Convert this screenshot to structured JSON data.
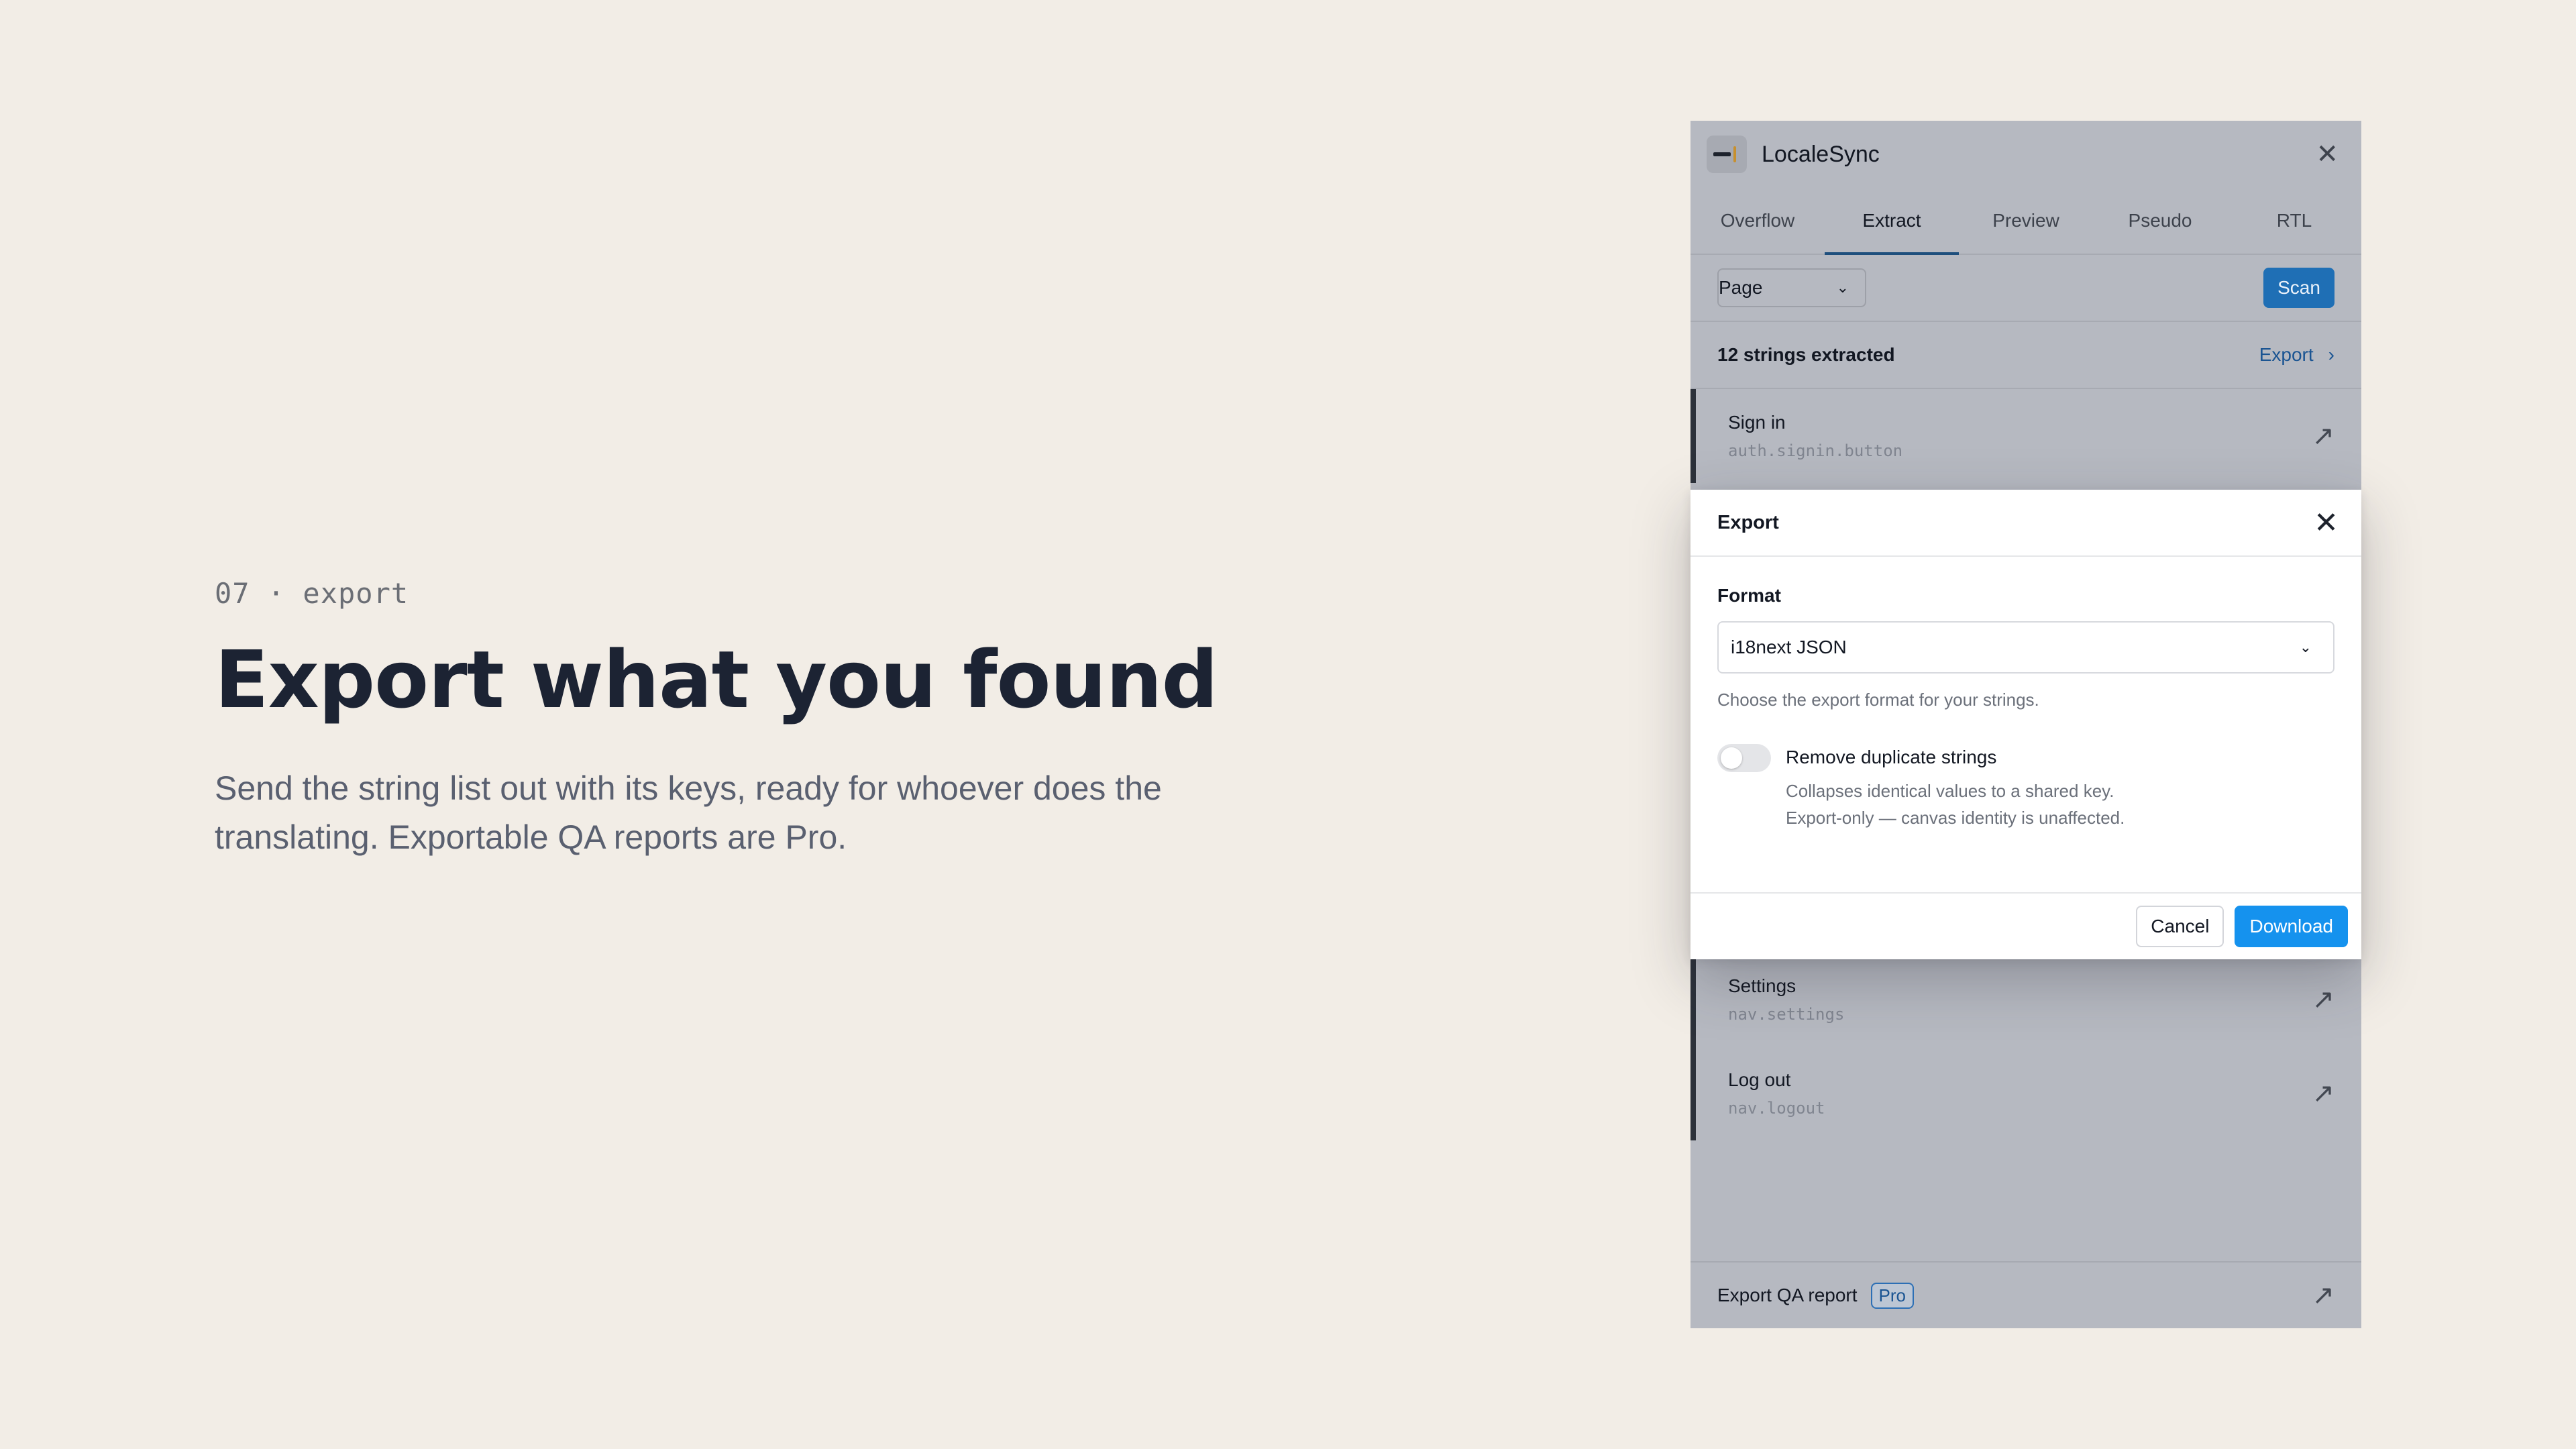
{
  "hero": {
    "eyebrow": "07 · export",
    "headline": "Export what you found",
    "lede": "Send the string list out with its keys, ready for whoever does the translating. Exportable QA reports are Pro."
  },
  "panel": {
    "app_title": "LocaleSync",
    "close_glyph": "✕",
    "tabs": [
      {
        "label": "Overflow",
        "active": false
      },
      {
        "label": "Extract",
        "active": true
      },
      {
        "label": "Preview",
        "active": false
      },
      {
        "label": "Pseudo",
        "active": false
      },
      {
        "label": "RTL",
        "active": false
      }
    ],
    "scope_select": {
      "value": "Page"
    },
    "scan_label": "Scan",
    "summary": "12 strings extracted",
    "export_link": "Export",
    "strings": [
      {
        "label": "Sign in",
        "key": "auth.signin.button"
      },
      {
        "label": "Settings",
        "key": "nav.settings"
      },
      {
        "label": "Log out",
        "key": "nav.logout"
      }
    ],
    "footer": {
      "label": "Export QA report",
      "badge": "Pro"
    }
  },
  "dialog": {
    "title": "Export",
    "format_label": "Format",
    "format_value": "i18next JSON",
    "format_help": "Choose the export format for your strings.",
    "dedupe": {
      "label": "Remove duplicate strings",
      "description": "Collapses identical values to a shared key. Export-only — canvas identity is unaffected.",
      "enabled": false
    },
    "cancel_label": "Cancel",
    "download_label": "Download"
  },
  "colors": {
    "accent": "#1592ee",
    "scan_button": "#1f6fb5",
    "headline": "#1c2333",
    "background": "#f2ede6"
  }
}
